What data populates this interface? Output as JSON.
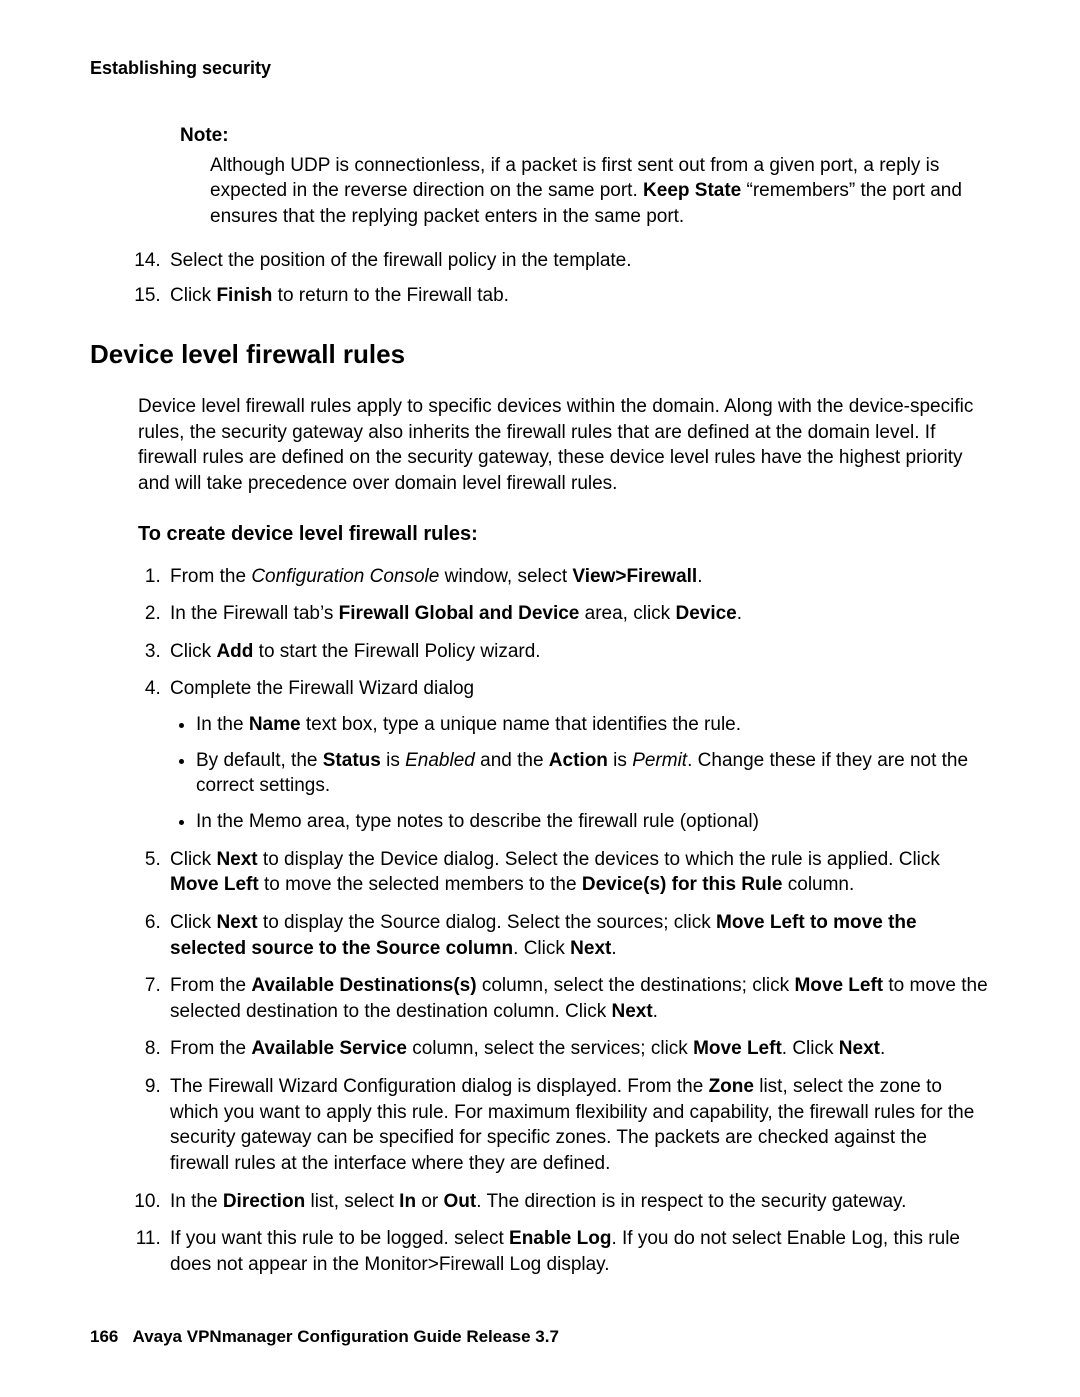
{
  "header": {
    "running_title": "Establishing security"
  },
  "note": {
    "label": "Note:",
    "body_pre": "Although UDP is connectionless, if a packet is first sent out from a given port, a reply is expected in the reverse direction on the same port. ",
    "body_bold": "Keep State",
    "body_post": " “remembers” the port and ensures that the replying packet enters in the same port."
  },
  "cont_list": {
    "item14": "Select the position of the firewall policy in the template.",
    "item15_pre": "Click ",
    "item15_b": "Finish",
    "item15_post": " to return to the Firewall tab."
  },
  "section": {
    "heading": "Device level firewall rules",
    "intro": "Device level firewall rules apply to specific devices within the domain. Along with the device-specific rules, the security gateway also inherits the firewall rules that are defined at the domain level. If firewall rules are defined on the security gateway, these device level rules have the highest priority and will take precedence over domain level firewall rules.",
    "sub_heading": "To create device level firewall rules:"
  },
  "steps": {
    "s1": {
      "pre": "From the ",
      "i1": "Configuration Console",
      "mid": " window, select ",
      "b1": "View>Firewall",
      "post": "."
    },
    "s2": {
      "pre": "In the Firewall tab’s ",
      "b1": "Firewall Global and Device",
      "mid": " area, click ",
      "b2": "Device",
      "post": "."
    },
    "s3": {
      "pre": "Click ",
      "b1": "Add",
      "post": " to start the Firewall Policy wizard."
    },
    "s4": {
      "text": "Complete the Firewall Wizard dialog",
      "bul1": {
        "pre": "In the ",
        "b1": "Name",
        "post": " text box, type a unique name that identifies the rule."
      },
      "bul2": {
        "pre": "By default, the ",
        "b1": "Status",
        "mid1": " is ",
        "i1": "Enabled",
        "mid2": " and the ",
        "b2": "Action",
        "mid3": " is ",
        "i2": "Permit",
        "post": ". Change these if they are not the correct settings."
      },
      "bul3": {
        "text": "In the Memo area, type notes to describe the firewall rule (optional)"
      }
    },
    "s5": {
      "pre": "Click ",
      "b1": "Next",
      "mid1": " to display the Device dialog. Select the devices to which the rule is applied. Click ",
      "b2": "Move Left",
      "mid2": " to move the selected members to the ",
      "b3": "Device(s) for this Rule",
      "post": " column."
    },
    "s6": {
      "pre": "Click ",
      "b1": "Next",
      "mid1": " to display the Source dialog. Select the sources; click ",
      "b2": "Move Left to move the selected source to the Source column",
      "mid2": ". Click ",
      "b3": "Next",
      "post": "."
    },
    "s7": {
      "pre": "From the ",
      "b1": "Available Destinations(s)",
      "mid1": " column, select the destinations; click ",
      "b2": "Move Left",
      "mid2": " to move the selected destination to the destination column. Click ",
      "b3": "Next",
      "post": "."
    },
    "s8": {
      "pre": "From the ",
      "b1": "Available Service",
      "mid1": " column, select the services; click ",
      "b2": "Move Left",
      "mid2": ". Click ",
      "b3": "Next",
      "post": "."
    },
    "s9": {
      "pre": "The Firewall Wizard Configuration dialog is displayed. From the ",
      "b1": "Zone",
      "post": " list, select the zone to which you want to apply this rule. For maximum flexibility and capability, the firewall rules for the security gateway can be specified for specific zones. The packets are checked against the firewall rules at the interface where they are defined."
    },
    "s10": {
      "pre": "In the ",
      "b1": "Direction",
      "mid1": " list, select ",
      "b2": "In",
      "mid2": " or ",
      "b3": "Out",
      "post": ". The direction is in respect to the security gateway."
    },
    "s11": {
      "pre": "If you want this rule to be logged. select ",
      "b1": "Enable Log",
      "post": ". If you do not select Enable Log, this rule does not appear in the Monitor>Firewall Log display."
    }
  },
  "footer": {
    "page_num": "166",
    "title": "Avaya VPNmanager Configuration Guide Release 3.7"
  }
}
